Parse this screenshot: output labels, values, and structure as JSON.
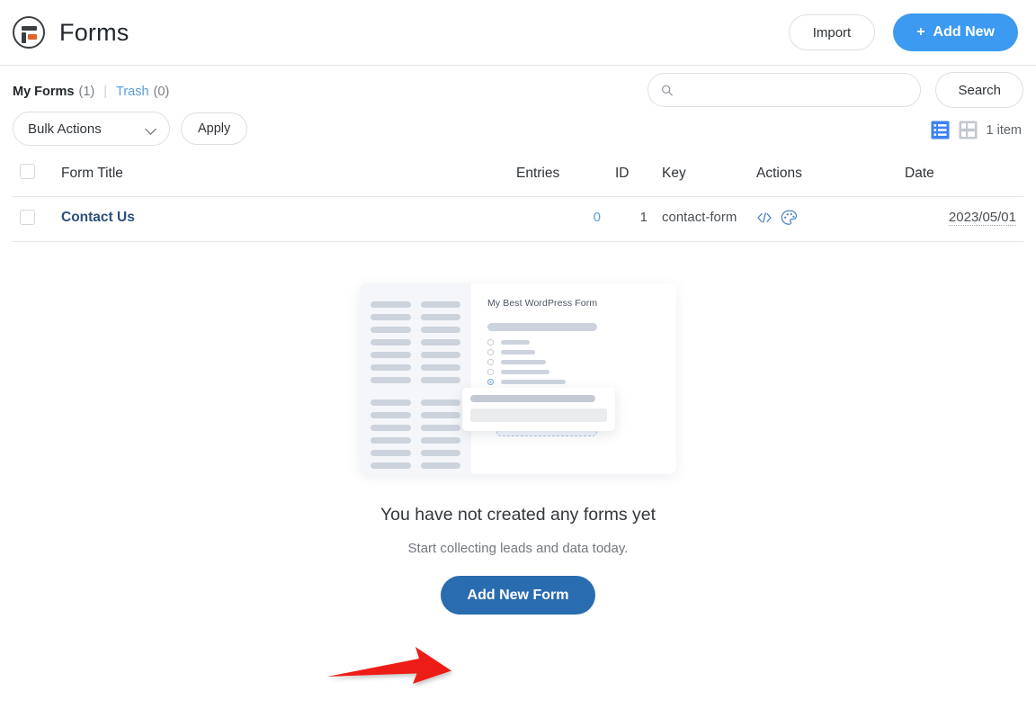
{
  "header": {
    "logo_icon": "fluentforms-logo-icon",
    "title": "Forms",
    "import_label": "Import",
    "add_new_plus": "+",
    "add_new_label": "Add New",
    "accent_blue": "#3c9af0"
  },
  "subnav": {
    "my_forms_label": "My Forms",
    "my_forms_count": "(1)",
    "separator": "|",
    "trash_label": "Trash",
    "trash_count": "(0)",
    "trash_link_color": "#5b9dd9"
  },
  "tools": {
    "bulk_actions_label": "Bulk Actions",
    "chevron_icon": "chevron-down-icon",
    "apply_label": "Apply",
    "search_icon": "search-icon",
    "search_value": "",
    "search_placeholder": "",
    "search_button_label": "Search",
    "list_view_icon": "list-view-icon",
    "excerpt_view_icon": "excerpt-view-icon",
    "item_count_label": "1 item",
    "active_view": "list"
  },
  "table": {
    "columns": [
      "Form Title",
      "Entries",
      "ID",
      "Key",
      "Actions",
      "Date"
    ],
    "rows": [
      {
        "title": "Contact Us",
        "entries": "0",
        "id": "1",
        "key": "contact-form",
        "actions": [
          "shortcode-icon",
          "palette-icon"
        ],
        "date": "2023/05/01"
      }
    ]
  },
  "illustration": {
    "card_title": "My Best WordPress Form",
    "skeleton_top_rows": 7,
    "skeleton_bottom_rows": 6,
    "radio_items": 7,
    "radio_selected_index": 4,
    "dropzone_color": "#f2f7fd"
  },
  "empty_state": {
    "title": "You have not created any forms yet",
    "subtitle": "Start collecting leads and data today.",
    "button_label": "Add New Form",
    "button_color": "#2a6cb0"
  },
  "annotation": {
    "arrow_icon": "red-arrow-icon",
    "arrow_color": "#ee1c13"
  }
}
